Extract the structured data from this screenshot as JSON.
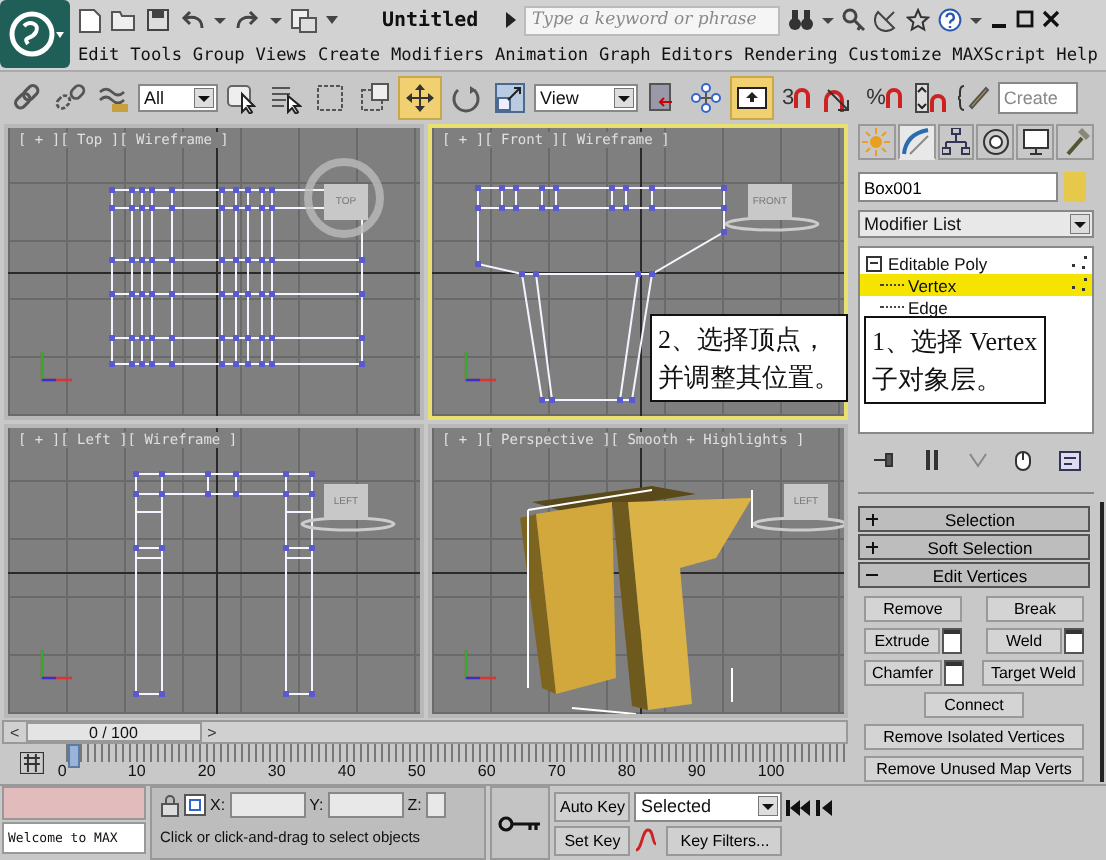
{
  "title_bar": {
    "title": "Untitled",
    "search": {
      "placeholder": "Type a keyword or phrase"
    }
  },
  "menu": [
    "Edit",
    "Tools",
    "Group",
    "Views",
    "Create",
    "Modifiers",
    "Animation",
    "Graph Editors",
    "Rendering",
    "Customize",
    "MAXScript",
    "Help"
  ],
  "toolbar": {
    "selection_filter": "All",
    "move_selected": true,
    "reference_coordinate": "View",
    "override_on": true,
    "snap_label": "3",
    "percent_label": "%",
    "named_selection": "Create"
  },
  "viewports": [
    {
      "label": "[ + ][ Top ][ Wireframe ]",
      "active": false,
      "kind": "top",
      "viewcube": "TOP"
    },
    {
      "label": "[ + ][ Front ][ Wireframe ]",
      "active": true,
      "kind": "front",
      "viewcube": "FRONT"
    },
    {
      "label": "[ + ][ Left ][ Wireframe ]",
      "active": false,
      "kind": "left",
      "viewcube": "LEFT"
    },
    {
      "label": "[ + ][ Perspective ][ Smooth + Highlights ]",
      "active": false,
      "kind": "perspective",
      "viewcube": "LEFT"
    }
  ],
  "callouts": [
    {
      "lines": [
        "2、选择顶点，",
        "并调整其位置。"
      ]
    },
    {
      "lines": [
        "1、选择 Vertex",
        "子对象层。"
      ]
    }
  ],
  "command_panel": {
    "tabs": [
      {
        "selected": false
      },
      {
        "selected": true
      },
      {
        "selected": false
      },
      {
        "selected": false
      },
      {
        "selected": false
      },
      {
        "selected": false
      }
    ],
    "object_name": "Box001",
    "modifier_list": "Modifier List",
    "stack": [
      {
        "label": "Editable Poly",
        "expanded": true,
        "children": [
          {
            "label": "Vertex",
            "selected": true
          },
          {
            "label": "Edge",
            "selected": false
          }
        ]
      }
    ],
    "rollouts": [
      {
        "label": "Selection",
        "expanded": false
      },
      {
        "label": "Soft Selection",
        "expanded": false
      },
      {
        "label": "Edit Vertices",
        "expanded": true
      }
    ],
    "buttons": [
      [
        {
          "label": "Remove",
          "settings": false
        },
        {
          "label": "Break",
          "settings": false
        }
      ],
      [
        {
          "label": "Extrude",
          "settings": true
        },
        {
          "label": "Weld",
          "settings": true
        }
      ],
      [
        {
          "label": "Chamfer",
          "settings": true
        },
        {
          "label": "Target Weld",
          "settings": false
        }
      ],
      [
        {
          "label": "Connect",
          "settings": false
        }
      ],
      [
        {
          "label": "Remove Isolated Vertices",
          "settings": false
        }
      ],
      [
        {
          "label": "Remove Unused Map Verts",
          "settings": false
        }
      ]
    ]
  },
  "time_slider": {
    "previous": "<",
    "frame": "0 / 100",
    "next": ">",
    "ticks": [
      "0",
      "10",
      "20",
      "30",
      "40",
      "50",
      "60",
      "70",
      "80",
      "90",
      "100"
    ]
  },
  "status_bar": {
    "listener_output": "Welcome to MAX",
    "x_label": "X:",
    "y_label": "Y:",
    "z_label": "Z:",
    "prompt": "Click or click-and-drag to select objects",
    "auto_key": "Auto Key",
    "set_key": "Set Key",
    "key_mode": "Selected",
    "key_filters": "Key Filters..."
  }
}
